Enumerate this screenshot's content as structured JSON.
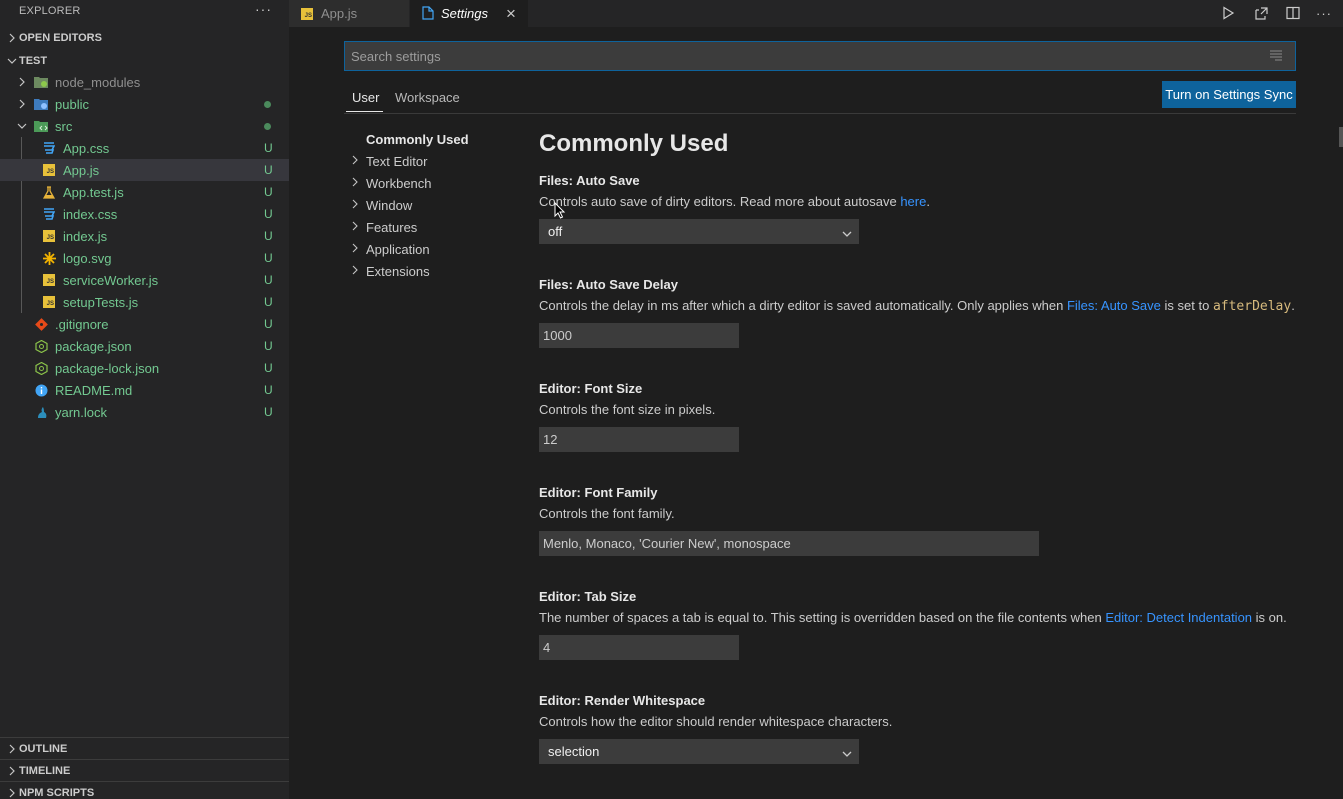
{
  "sidebar": {
    "title": "EXPLORER",
    "more": "···",
    "sections": {
      "open_editors": "OPEN EDITORS",
      "project": "TEST",
      "outline": "OUTLINE",
      "timeline": "TIMELINE",
      "npm_scripts": "NPM SCRIPTS"
    },
    "tree": [
      {
        "label": "node_modules",
        "badge": ""
      },
      {
        "label": "public",
        "badge": ""
      },
      {
        "label": "src",
        "badge": ""
      },
      {
        "label": "App.css",
        "badge": "U"
      },
      {
        "label": "App.js",
        "badge": "U"
      },
      {
        "label": "App.test.js",
        "badge": "U"
      },
      {
        "label": "index.css",
        "badge": "U"
      },
      {
        "label": "index.js",
        "badge": "U"
      },
      {
        "label": "logo.svg",
        "badge": "U"
      },
      {
        "label": "serviceWorker.js",
        "badge": "U"
      },
      {
        "label": "setupTests.js",
        "badge": "U"
      },
      {
        "label": ".gitignore",
        "badge": "U"
      },
      {
        "label": "package.json",
        "badge": "U"
      },
      {
        "label": "package-lock.json",
        "badge": "U"
      },
      {
        "label": "README.md",
        "badge": "U"
      },
      {
        "label": "yarn.lock",
        "badge": "U"
      }
    ]
  },
  "tabs": [
    {
      "label": "App.js",
      "icon_text": "JS"
    },
    {
      "label": "Settings",
      "close": "×"
    }
  ],
  "settings": {
    "search_placeholder": "Search settings",
    "scope_tabs": [
      "User",
      "Workspace"
    ],
    "sync_button": "Turn on Settings Sync",
    "toc": [
      "Commonly Used",
      "Text Editor",
      "Workbench",
      "Window",
      "Features",
      "Application",
      "Extensions"
    ],
    "heading": "Commonly Used",
    "items": [
      {
        "category": "Files: ",
        "name": "Auto Save",
        "desc_pre": "Controls auto save of dirty editors. Read more about autosave ",
        "desc_link": "here",
        "desc_post": ".",
        "value": "off"
      },
      {
        "category": "Files: ",
        "name": "Auto Save Delay",
        "desc_pre": "Controls the delay in ms after which a dirty editor is saved automatically. Only applies when ",
        "desc_link": "Files: Auto Save",
        "desc_mid": " is set to ",
        "desc_code": "afterDelay",
        "desc_post": ".",
        "value": "1000"
      },
      {
        "category": "Editor: ",
        "name": "Font Size",
        "desc": "Controls the font size in pixels.",
        "value": "12"
      },
      {
        "category": "Editor: ",
        "name": "Font Family",
        "desc": "Controls the font family.",
        "value": "Menlo, Monaco, 'Courier New', monospace"
      },
      {
        "category": "Editor: ",
        "name": "Tab Size",
        "desc_pre": "The number of spaces a tab is equal to. This setting is overridden based on the file contents when ",
        "desc_link": "Editor: Detect Indentation",
        "desc_post": " is on.",
        "value": "4"
      },
      {
        "category": "Editor: ",
        "name": "Render Whitespace",
        "desc": "Controls how the editor should render whitespace characters.",
        "value": "selection"
      }
    ]
  },
  "colors": {
    "accent": "#0e639c",
    "link": "#3794ff",
    "untracked": "#73c991"
  }
}
